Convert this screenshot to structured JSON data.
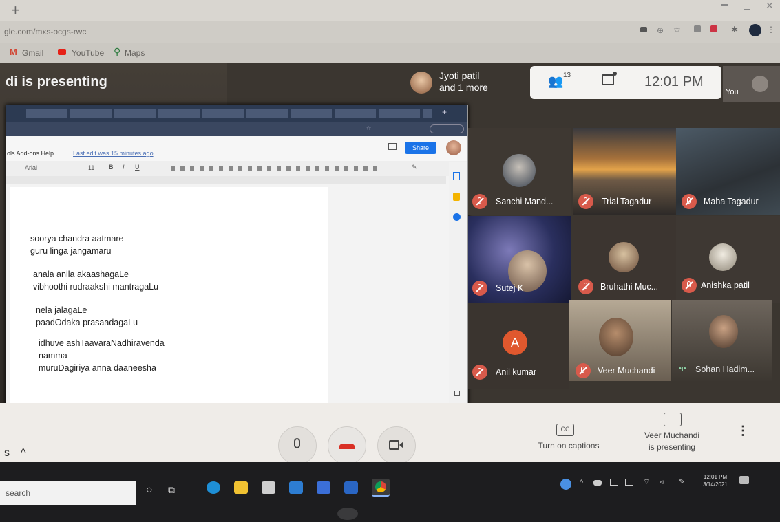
{
  "browser": {
    "new_tab_glyph": "+",
    "url": "gle.com/mxs-ocgs-rwc",
    "bookmarks": [
      {
        "label": "Gmail",
        "color": "#d14836"
      },
      {
        "label": "YouTube",
        "color": "#e62117"
      },
      {
        "label": "Maps",
        "color": "#2b7a3d"
      }
    ]
  },
  "meet": {
    "presenting_title": "di is presenting",
    "participants_chip": {
      "line1": "Jyoti patil",
      "line2": "and 1 more"
    },
    "toolbar": {
      "people_count": "13",
      "time": "12:01 PM",
      "you_label": "You"
    }
  },
  "share": {
    "docbar_left": "ols  Add-ons  Help",
    "last_edit": "Last edit was 15 minutes ago",
    "share_button": "Share",
    "toolbar_font": "Arial",
    "toolbar_size": "11",
    "doc_lines": [
      "soorya chandra aatmare",
      "guru linga jangamaru",
      "anala anila akaashagaLe",
      "vibhoothi rudraakshi mantragaLu",
      "nela jalagaLe",
      "paadOdaka prasaadagaLu",
      "idhuve ashTaavaraNadhiravenda",
      "namma",
      "muruDagiriya anna daaneesha"
    ]
  },
  "participants": [
    {
      "name": "Sanchi Mand...",
      "avatar_bg": "#5c6a78"
    },
    {
      "name": "Trial Tagadur"
    },
    {
      "name": "Maha Tagadur"
    },
    {
      "name": "Sutej K"
    },
    {
      "name": "Bruhathi Muc..."
    },
    {
      "name": "Anishka patil"
    },
    {
      "name": "Anil kumar",
      "initial": "A",
      "avatar_color": "#e0582e"
    },
    {
      "name": "Veer Muchandi"
    },
    {
      "name": "Sohan Hadim..."
    }
  ],
  "controls": {
    "captions_label": "Turn on captions",
    "cc_glyph": "CC",
    "presenting_label_1": "Veer Muchandi",
    "presenting_label_2": "is presenting",
    "more_glyph": "⋮",
    "details_label": "s",
    "chevron_glyph": "^"
  },
  "taskbar": {
    "search_text": "search",
    "clock_time": "12:01 PM",
    "clock_date": "3/14/2021"
  },
  "colors": {
    "end_call_red": "#d93025",
    "mic_muted": "#d85a4b",
    "share_blue": "#1a73e8"
  }
}
